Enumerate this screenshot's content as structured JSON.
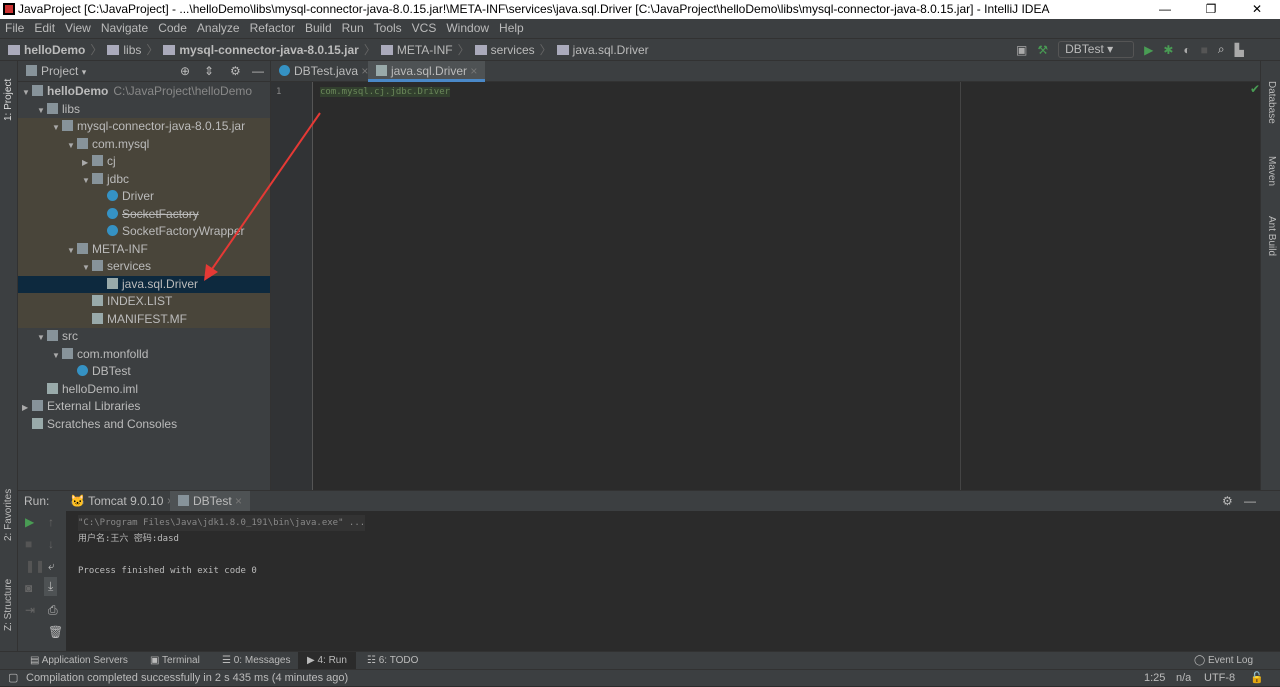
{
  "window": {
    "title": "JavaProject [C:\\JavaProject] - ...\\helloDemo\\libs\\mysql-connector-java-8.0.15.jar!\\META-INF\\services\\java.sql.Driver [C:\\JavaProject\\helloDemo\\libs\\mysql-connector-java-8.0.15.jar] - IntelliJ IDEA",
    "minimize": "—",
    "restore": "❐",
    "close": "✕"
  },
  "menu": [
    "File",
    "Edit",
    "View",
    "Navigate",
    "Code",
    "Analyze",
    "Refactor",
    "Build",
    "Run",
    "Tools",
    "VCS",
    "Window",
    "Help"
  ],
  "breadcrumb": [
    "helloDemo",
    "libs",
    "mysql-connector-java-8.0.15.jar",
    "META-INF",
    "services",
    "java.sql.Driver"
  ],
  "toolbar": {
    "run_config": "DBTest"
  },
  "left_strip": {
    "project": "1: Project",
    "favorites": "2: Favorites",
    "structure": "Z: Structure"
  },
  "right_strip": [
    "Database",
    "Maven",
    "Ant Build"
  ],
  "project": {
    "header": "Project",
    "tree": [
      {
        "label": "helloDemo",
        "extra": "C:\\JavaProject\\helloDemo",
        "depth": 0,
        "icon": "module",
        "open": true
      },
      {
        "label": "libs",
        "depth": 1,
        "icon": "folder",
        "open": true
      },
      {
        "label": "mysql-connector-java-8.0.15.jar",
        "depth": 2,
        "icon": "jar",
        "open": true,
        "jar": true
      },
      {
        "label": "com.mysql",
        "depth": 3,
        "icon": "package",
        "open": true,
        "jar": true
      },
      {
        "label": "cj",
        "depth": 4,
        "icon": "package",
        "open": false,
        "jar": true
      },
      {
        "label": "jdbc",
        "depth": 4,
        "icon": "package",
        "open": true,
        "jar": true
      },
      {
        "label": "Driver",
        "depth": 5,
        "icon": "class",
        "jar": true
      },
      {
        "label": "SocketFactory",
        "depth": 5,
        "icon": "class",
        "jar": true,
        "strike": true
      },
      {
        "label": "SocketFactoryWrapper",
        "depth": 5,
        "icon": "class",
        "jar": true
      },
      {
        "label": "META-INF",
        "depth": 3,
        "icon": "package",
        "open": true,
        "jar": true
      },
      {
        "label": "services",
        "depth": 4,
        "icon": "package",
        "open": true,
        "jar": true
      },
      {
        "label": "java.sql.Driver",
        "depth": 5,
        "icon": "file",
        "jar": true,
        "selected": true
      },
      {
        "label": "INDEX.LIST",
        "depth": 4,
        "icon": "file",
        "jar": true
      },
      {
        "label": "MANIFEST.MF",
        "depth": 4,
        "icon": "file",
        "jar": true
      },
      {
        "label": "src",
        "depth": 1,
        "icon": "folder",
        "open": true
      },
      {
        "label": "com.monfolld",
        "depth": 2,
        "icon": "package",
        "open": true
      },
      {
        "label": "DBTest",
        "depth": 3,
        "icon": "class"
      },
      {
        "label": "helloDemo.iml",
        "depth": 1,
        "icon": "file"
      },
      {
        "label": "External Libraries",
        "depth": 0,
        "icon": "library",
        "open": false,
        "closed": true
      },
      {
        "label": "Scratches and Consoles",
        "depth": 0,
        "icon": "scratch"
      }
    ]
  },
  "editor": {
    "tabs": [
      "DBTest.java",
      "java.sql.Driver"
    ],
    "active_tab": 1,
    "line_numbers": [
      "1"
    ],
    "code": "com.mysql.cj.jdbc.Driver"
  },
  "run": {
    "label": "Run:",
    "tabs": [
      "Tomcat 9.0.10",
      "DBTest"
    ],
    "console": [
      "\"C:\\Program Files\\Java\\jdk1.8.0_191\\bin\\java.exe\" ...",
      "用户名:王六   密码:dasd",
      "",
      "Process finished with exit code 0"
    ]
  },
  "bottom_tabs": [
    "Application Servers",
    "Terminal",
    "0: Messages",
    "4: Run",
    "6: TODO"
  ],
  "event_log": "Event Log",
  "status": {
    "message": "Compilation completed successfully in 2 s 435 ms (4 minutes ago)",
    "position": "1:25",
    "separator": "n/a",
    "encoding": "UTF-8"
  },
  "colors": {
    "accent": "#4a88c7",
    "jar_bg": "#49453a",
    "selected_bg": "#0d293e",
    "arrow": "#e53935",
    "run_green": "#499c54"
  }
}
